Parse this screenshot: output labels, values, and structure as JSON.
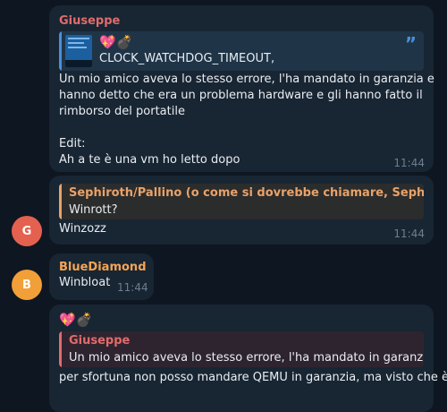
{
  "colors": {
    "background": "#0e1621",
    "bubble": "#182533",
    "giuseppe": "#e06c6c",
    "sephiroth": "#e8a26a",
    "bluediamond": "#f5a453",
    "quote_bar_blue": "#4a90d9",
    "avatar_g": "#e4614f",
    "avatar_b": "#f19f38",
    "time": "#6d7f8f"
  },
  "messages": [
    {
      "sender": "Giuseppe",
      "quote": {
        "emojis": "💖💣",
        "text": "CLOCK_WATCHDOG_TIMEOUT,",
        "quote_mark": "”"
      },
      "lines": [
        "Un mio amico aveva lo stesso errore, l'ha mandato in garanzia e",
        "hanno detto che era un problema hardware e gli hanno fatto il",
        "rimborso del portatile",
        "",
        "Edit:",
        "Ah a te è una vm ho letto dopo"
      ],
      "time": "11:44"
    },
    {
      "quote": {
        "sender": "Sephiroth/Pallino (o come si dovrebbe chiamare, Sephiroth + ...",
        "text": "Winrott?"
      },
      "text": "Winzozz",
      "time": "11:44",
      "avatar": "G"
    },
    {
      "sender": "BlueDiamond",
      "text": "Winbloat",
      "time": "11:44",
      "avatar": "B"
    },
    {
      "emojis": "💖💣",
      "quote": {
        "sender": "Giuseppe",
        "text": "Un mio amico aveva lo stesso errore, l'ha mandato in garanzia e ..."
      },
      "text": "per sfortuna non posso mandare QEMU in garanzia, ma visto che è"
    }
  ]
}
